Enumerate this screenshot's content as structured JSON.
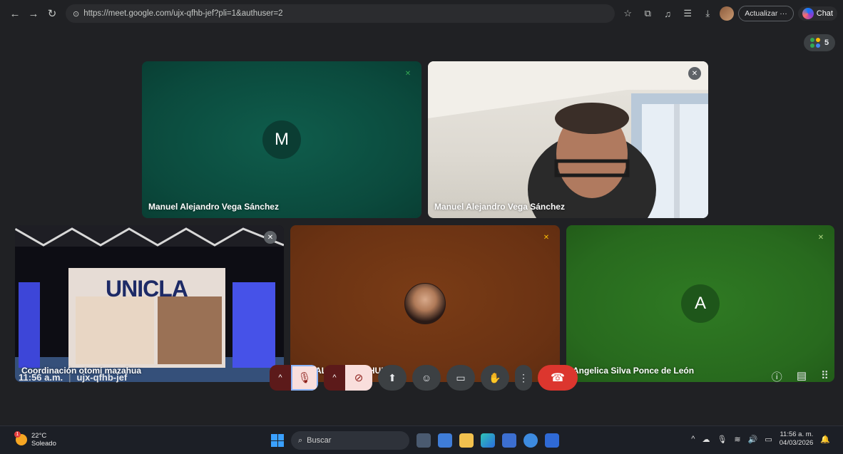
{
  "browser": {
    "url": "https://meet.google.com/ujx-qfhb-jef?pli=1&authuser=2",
    "update_label": "Actualizar",
    "chat_label": "Chat"
  },
  "meet": {
    "participant_count": "5",
    "tiles": [
      {
        "name": "Manuel Alejandro Vega Sánchez",
        "initial": "M",
        "muted": true
      },
      {
        "name": "Manuel Alejandro Vega Sánchez",
        "muted": true
      },
      {
        "name": "Coordinación otomí mazahua",
        "muted": true,
        "banner_text": "UNICLA"
      },
      {
        "name": "ROSALBA DIEGOHUIPE",
        "muted": true
      },
      {
        "name": "Angelica Silva Ponce de León",
        "initial": "A",
        "muted": true
      }
    ],
    "time": "11:56 a.m.",
    "separator": "|",
    "meeting_code": "ujx-qfhb-jef",
    "colors": {
      "accent_red": "#dc362e",
      "mic_off_bg": "#f9dedc",
      "tile_green_dark": "#0b4a3d",
      "tile_green": "#286a1e",
      "tile_brown": "#6a3213"
    }
  },
  "taskbar": {
    "temperature": "22°C",
    "weather": "Soleado",
    "notification_count": "1",
    "search_placeholder": "Buscar",
    "clock_time": "11:56 a. m.",
    "clock_date": "04/03/2026"
  }
}
